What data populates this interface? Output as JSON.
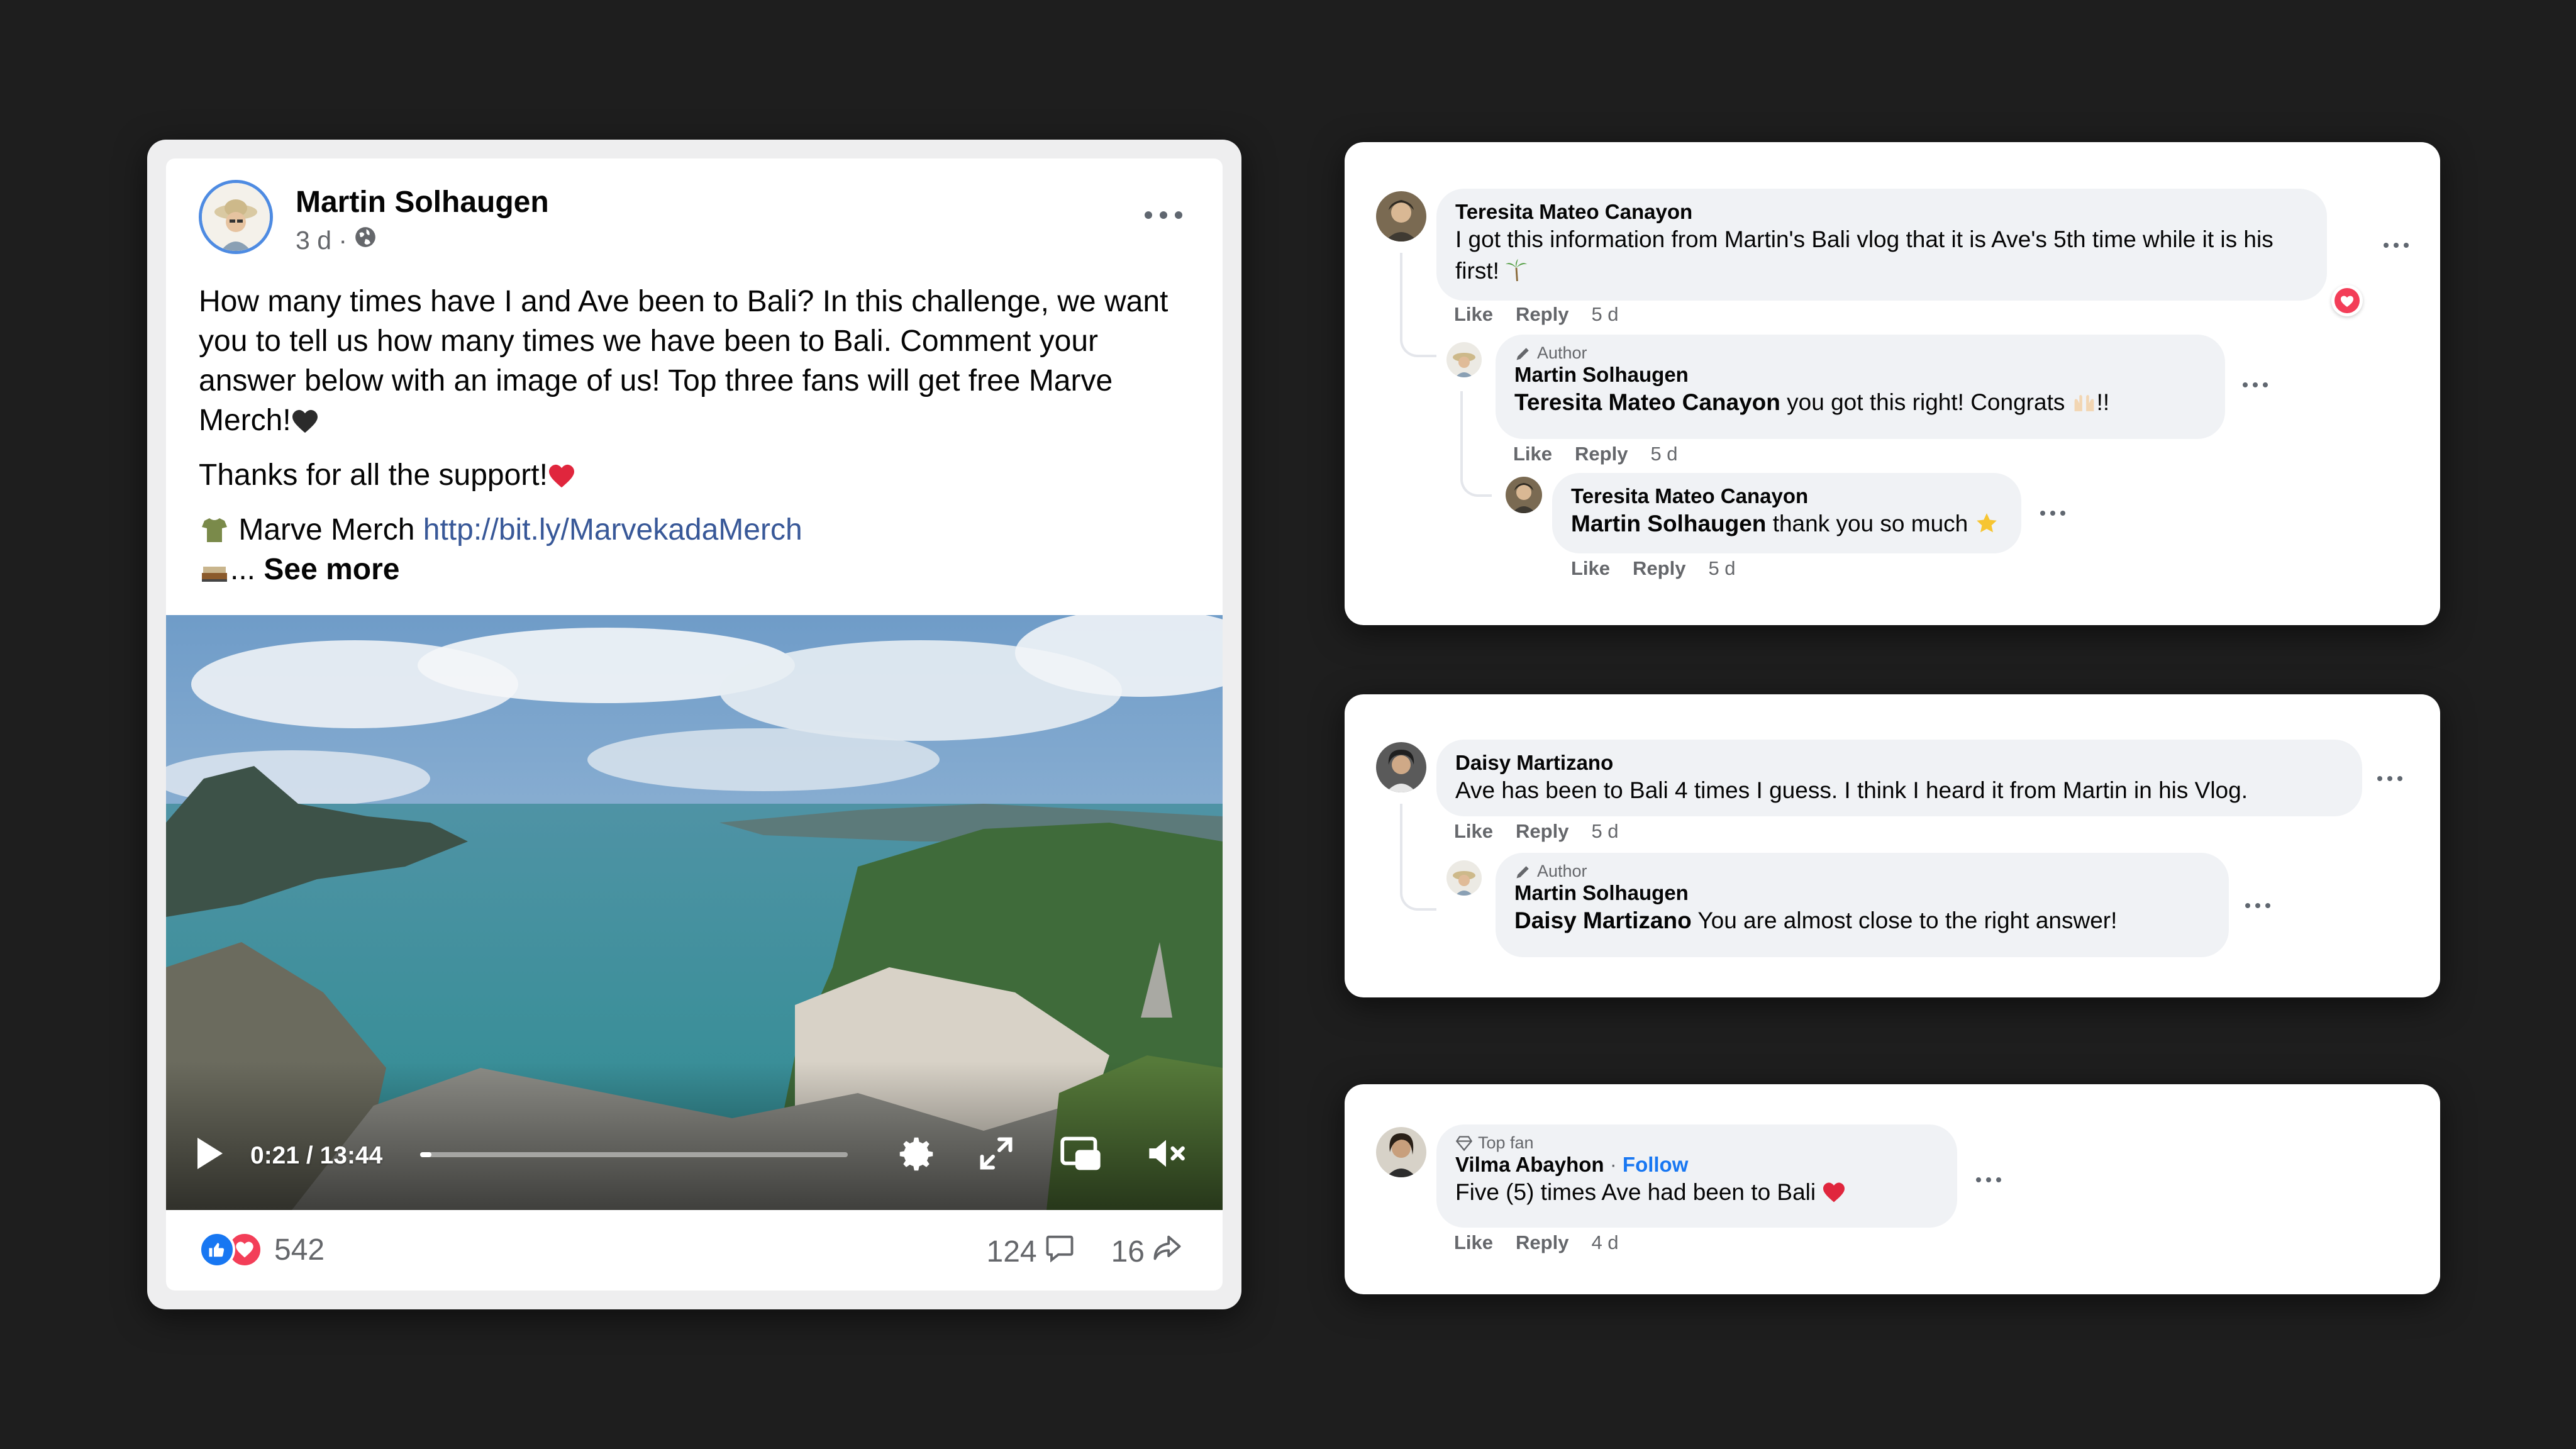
{
  "post": {
    "author": "Martin Solhaugen",
    "time": "3 d ·",
    "privacy_icon": "globe-icon",
    "paragraph1": "How many times have I and Ave been to Bali? In this challenge, we want you to tell us how many times we have been to Bali. Comment your answer below with an image of us! Top three fans will get free Marve Merch!",
    "paragraph1_emoji": "black-heart",
    "paragraph2": "Thanks for all the support!",
    "paragraph2_emoji": "red-heart",
    "merch_label": "Marve Merch",
    "merch_link": "http://bit.ly/MarvekadaMerch",
    "ellipsis": "...",
    "see_more": "See more",
    "video": {
      "time": "0:21 / 13:44",
      "progress_fraction": 0.026
    },
    "reaction_count": "542",
    "comment_count": "124",
    "share_count": "16"
  },
  "comments": [
    {
      "name": "Teresita Mateo Canayon",
      "text": "I got this information from Martin's Bali vlog that it is Ave's 5th time while it is his first!",
      "actions": {
        "like": "Like",
        "reply": "Reply",
        "time": "5 d"
      },
      "reaction": "love",
      "replies": [
        {
          "badge": "Author",
          "name": "Martin Solhaugen",
          "mention": "Teresita Mateo Canayon",
          "text": "you got this right! Congrats",
          "text_end": "!!",
          "actions": {
            "like": "Like",
            "reply": "Reply",
            "time": "5 d"
          }
        },
        {
          "name": "Teresita Mateo Canayon",
          "mention": "Martin Solhaugen",
          "text": "thank you so much",
          "actions": {
            "like": "Like",
            "reply": "Reply",
            "time": "5 d"
          }
        }
      ]
    },
    {
      "name": "Daisy Martizano",
      "text": "Ave has been to Bali 4 times I guess. I think I heard it from Martin in his Vlog.",
      "actions": {
        "like": "Like",
        "reply": "Reply",
        "time": "5 d"
      },
      "replies": [
        {
          "badge": "Author",
          "name": "Martin Solhaugen",
          "mention": "Daisy Martizano",
          "text": "You are almost close to the right answer!"
        }
      ]
    },
    {
      "badge": "Top fan",
      "name": "Vilma Abayhon",
      "follow": "Follow",
      "separator": "·",
      "text": "Five (5) times Ave had been to Bali",
      "actions": {
        "like": "Like",
        "reply": "Reply",
        "time": "4 d"
      }
    }
  ],
  "colors": {
    "background": "#1e1e1e",
    "link": "#385898",
    "like_blue": "#1877f2",
    "love_red": "#f33e58",
    "bubble": "#f0f2f5",
    "secondary_text": "#65676b"
  }
}
